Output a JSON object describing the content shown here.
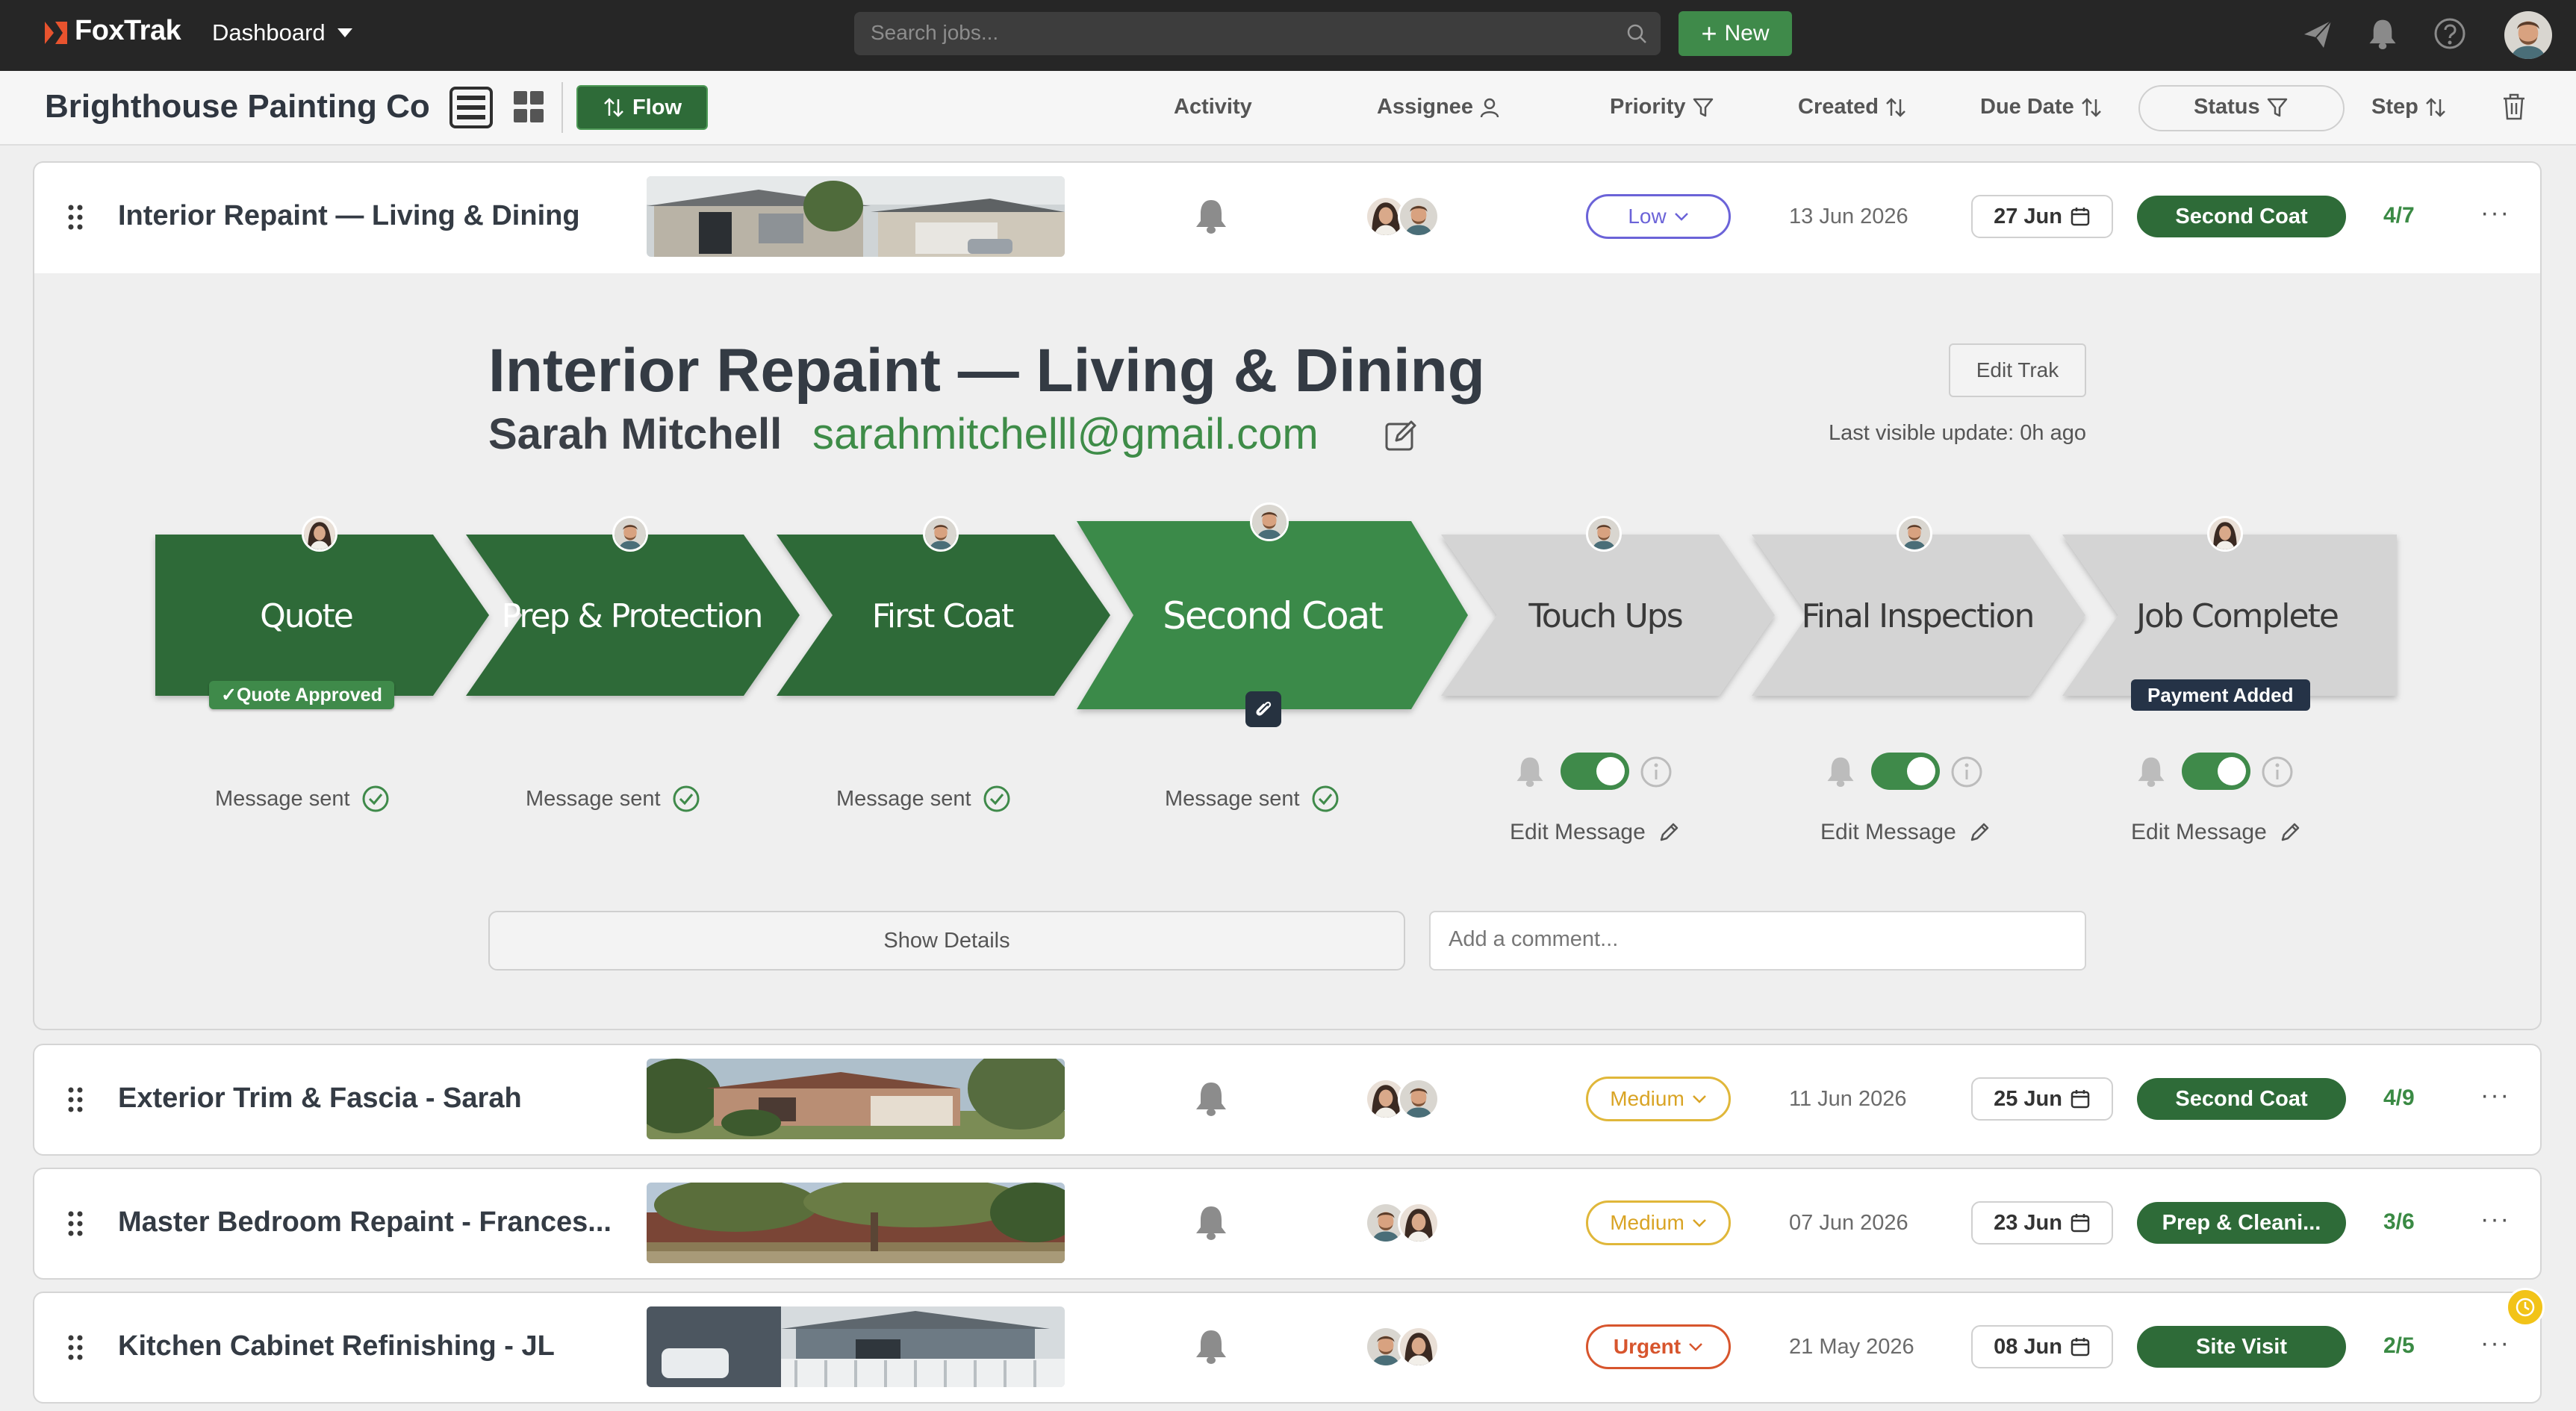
{
  "app": {
    "name": "FoxTrak",
    "menu_label": "Dashboard",
    "search_placeholder": "Search jobs...",
    "new_label": "New"
  },
  "colors": {
    "brand_green": "#2e6b38",
    "stage_done": "#2e6b38",
    "stage_current": "#3a8a48",
    "stage_pending": "#d4d4d4",
    "priority_low": "#6b63d8",
    "priority_medium": "#e0b73a",
    "priority_urgent": "#d7552d"
  },
  "toolbar": {
    "company": "Brighthouse Painting Co",
    "flow_label": "Flow",
    "columns": {
      "activity": "Activity",
      "assignee": "Assignee",
      "priority": "Priority",
      "created": "Created",
      "due_date": "Due Date",
      "status": "Status",
      "step": "Step"
    }
  },
  "jobs": [
    {
      "title": "Interior Repaint — Living & Dining",
      "priority": "Low",
      "created": "13 Jun 2026",
      "due": "27 Jun",
      "status": "Second Coat",
      "step": "4/7"
    },
    {
      "title": "Exterior Trim & Fascia - Sarah",
      "priority": "Medium",
      "created": "11 Jun 2026",
      "due": "25 Jun",
      "status": "Second Coat",
      "step": "4/9"
    },
    {
      "title": "Master Bedroom Repaint - Frances...",
      "priority": "Medium",
      "created": "07 Jun 2026",
      "due": "23 Jun",
      "status": "Prep & Cleani...",
      "step": "3/6"
    },
    {
      "title": "Kitchen Cabinet Refinishing - JL",
      "priority": "Urgent",
      "created": "21 May 2026",
      "due": "08 Jun",
      "status": "Site Visit",
      "step": "2/5"
    }
  ],
  "detail": {
    "title": "Interior Repaint — Living & Dining",
    "client": "Sarah Mitchell",
    "email": "sarahmitchelll@gmail.com",
    "edit_trak": "Edit Trak",
    "last_update": "Last visible update: 0h ago",
    "stages": [
      {
        "label": "Quote",
        "state": "done",
        "badge": "✓Quote Approved",
        "note": "Message sent"
      },
      {
        "label": "Prep & Protection",
        "state": "done",
        "note": "Message sent"
      },
      {
        "label": "First Coat",
        "state": "done",
        "note": "Message sent"
      },
      {
        "label": "Second Coat",
        "state": "current",
        "note": "Message sent"
      },
      {
        "label": "Touch Ups",
        "state": "pending",
        "note": "Edit Message",
        "toggle_on": true
      },
      {
        "label": "Final Inspection",
        "state": "pending",
        "note": "Edit Message",
        "toggle_on": true
      },
      {
        "label": "Job Complete",
        "state": "pending",
        "badge": "Payment Added",
        "note": "Edit Message",
        "toggle_on": true
      }
    ],
    "show_details": "Show Details",
    "comment_placeholder": "Add a comment..."
  }
}
